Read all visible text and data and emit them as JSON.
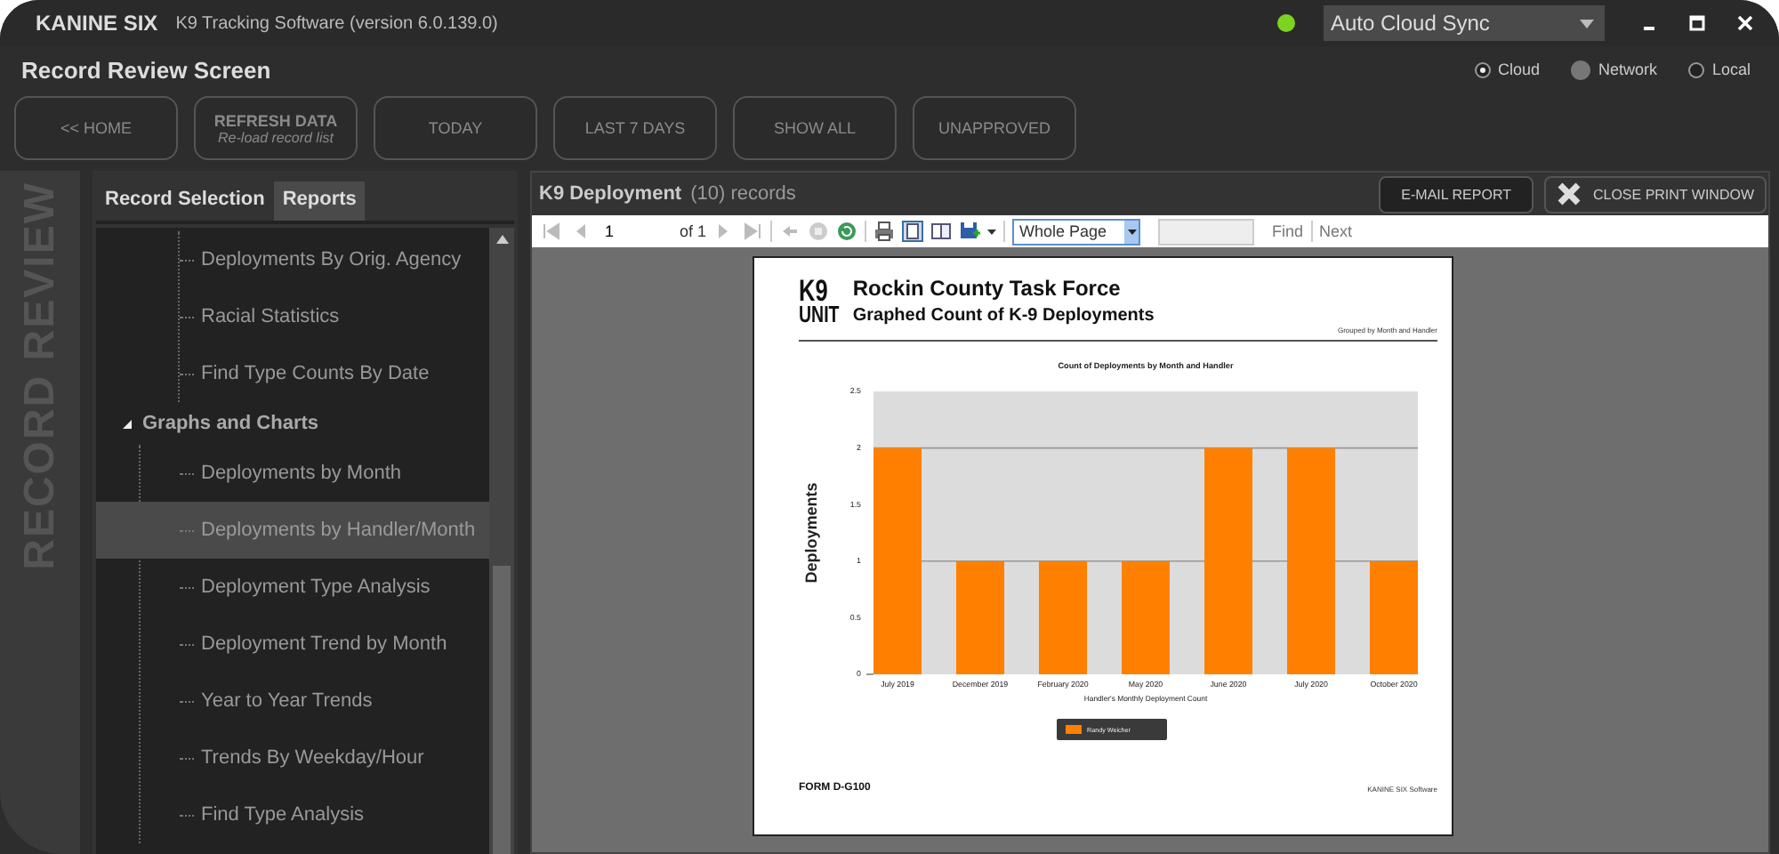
{
  "window": {
    "app_name": "KANINE SIX",
    "title": "K9 Tracking Software (version 6.0.139.0)",
    "sync_status": {
      "color": "#7dd321"
    },
    "sync_mode": "Auto Cloud Sync"
  },
  "screen_title": "Record Review Screen",
  "storage_options": [
    {
      "label": "Cloud",
      "selected": true,
      "disabled": false
    },
    {
      "label": "Network",
      "selected": false,
      "disabled": true
    },
    {
      "label": "Local",
      "selected": false,
      "disabled": false
    }
  ],
  "toolbar": [
    {
      "label": "<< HOME"
    },
    {
      "label": "REFRESH DATA",
      "subtitle": "Re-load record list"
    },
    {
      "label": "TODAY"
    },
    {
      "label": "LAST 7 DAYS"
    },
    {
      "label": "SHOW ALL"
    },
    {
      "label": "UNAPPROVED"
    }
  ],
  "side_label": "RECORD REVIEW",
  "tabs": [
    {
      "label": "Record Selection",
      "selected": false
    },
    {
      "label": "Reports",
      "selected": true
    }
  ],
  "tree": [
    {
      "children": [
        {
          "label": "Deployments By Orig. Agency",
          "selected": false
        },
        {
          "label": "Racial Statistics",
          "selected": false
        },
        {
          "label": "Find Type Counts By Date",
          "selected": false
        }
      ]
    },
    {
      "label": "Graphs and Charts",
      "expanded": true,
      "children": [
        {
          "label": "Deployments by Month",
          "selected": false
        },
        {
          "label": "Deployments by Handler/Month",
          "selected": true
        },
        {
          "label": "Deployment Type Analysis",
          "selected": false
        },
        {
          "label": "Deployment Trend by Month",
          "selected": false
        },
        {
          "label": "Year to Year Trends",
          "selected": false
        },
        {
          "label": "Trends By Weekday/Hour",
          "selected": false
        },
        {
          "label": "Find Type Analysis",
          "selected": false
        }
      ]
    }
  ],
  "report_panel": {
    "title": "K9 Deployment",
    "count": "(10) records",
    "buttons": [
      {
        "label": "E-MAIL REPORT",
        "kind": "plain"
      },
      {
        "label": "CLOSE PRINT WINDOW",
        "kind": "close"
      }
    ],
    "viewer": {
      "page": "1",
      "page_total": "of 1",
      "zoom": "Whole Page",
      "find": "Find",
      "next": "Next"
    },
    "report": {
      "logo_top": "K9",
      "logo_bottom": "UNIT",
      "organization": "Rockin County Task Force",
      "title": "Graphed Count of K-9 Deployments",
      "grouping": "Grouped by Month and Handler",
      "form": "FORM D-G100",
      "footer": "KANINE SIX Software",
      "chart_data": {
        "type": "bar",
        "title": "Count of Deployments by Month and Handler",
        "xlabel": "Handler's Monthly Deployment Count",
        "ylabel": "Deployments",
        "categories": [
          "July 2019",
          "December 2019",
          "February 2020",
          "May 2020",
          "June 2020",
          "July 2020",
          "October 2020"
        ],
        "series": [
          {
            "name": "Randy Weicher",
            "color": "#ff8000",
            "values": [
              2,
              1,
              1,
              1,
              2,
              2,
              1
            ]
          }
        ],
        "ylim": [
          0,
          2.5
        ],
        "yticks": [
          0,
          0.5,
          1,
          1.5,
          2,
          2.5
        ]
      }
    }
  }
}
